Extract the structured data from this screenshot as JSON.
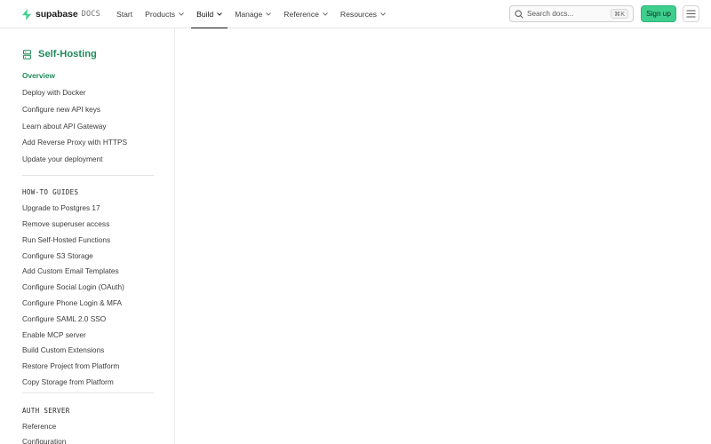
{
  "brand": {
    "name": "supabase",
    "sub": "DOCS",
    "accent": "#3ecf8e"
  },
  "nav": {
    "items": [
      {
        "label": "Start",
        "dropdown": false,
        "active": false
      },
      {
        "label": "Products",
        "dropdown": true,
        "active": false
      },
      {
        "label": "Build",
        "dropdown": true,
        "active": true
      },
      {
        "label": "Manage",
        "dropdown": true,
        "active": false
      },
      {
        "label": "Reference",
        "dropdown": true,
        "active": false
      },
      {
        "label": "Resources",
        "dropdown": true,
        "active": false
      }
    ]
  },
  "search": {
    "placeholder": "Search docs...",
    "shortcut": "⌘K"
  },
  "signup": {
    "label": "Sign up"
  },
  "sidebar": {
    "title": "Self-Hosting",
    "top_links": [
      "Overview",
      "Deploy with Docker",
      "Configure new API keys",
      "Learn about API Gateway",
      "Add Reverse Proxy with HTTPS",
      "Update your deployment"
    ],
    "guides_label": "HOW-TO GUIDES",
    "guides": [
      "Upgrade to Postgres 17",
      "Remove superuser access",
      "Run Self-Hosted Functions",
      "Configure S3 Storage",
      "Add Custom Email Templates",
      "Configure Social Login (OAuth)",
      "Configure Phone Login & MFA",
      "Configure SAML 2.0 SSO",
      "Enable MCP server",
      "Build Custom Extensions",
      "Restore Project from Platform",
      "Copy Storage from Platform"
    ],
    "auth_label": "AUTH SERVER",
    "auth": [
      "Reference",
      "Configuration"
    ]
  },
  "colors": {
    "active_link": "#1f8a5b",
    "signup_bg": "#3ecf8e"
  }
}
